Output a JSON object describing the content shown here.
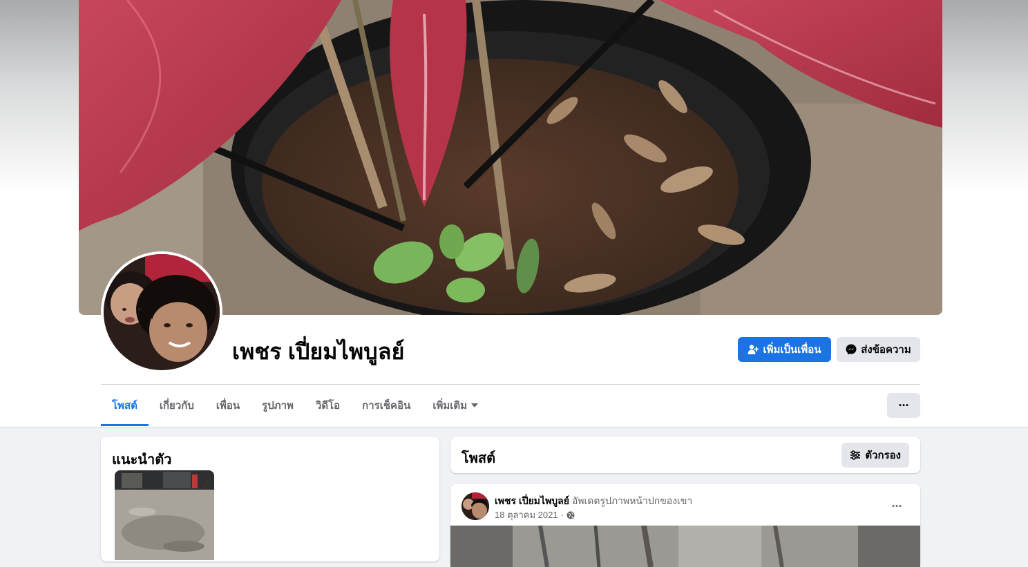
{
  "profile": {
    "name": "เพชร เปี่ยมไพบูลย์"
  },
  "actions": {
    "add_friend": "เพิ่มเป็นเพื่อน",
    "message": "ส่งข้อความ",
    "more": "···"
  },
  "tabs": [
    {
      "label": "โพสต์",
      "active": true
    },
    {
      "label": "เกี่ยวกับ",
      "active": false
    },
    {
      "label": "เพื่อน",
      "active": false
    },
    {
      "label": "รูปภาพ",
      "active": false
    },
    {
      "label": "วิดีโอ",
      "active": false
    },
    {
      "label": "การเช็คอิน",
      "active": false
    },
    {
      "label": "เพิ่มเติม",
      "active": false
    }
  ],
  "intro": {
    "title": "แนะนำตัว"
  },
  "posts": {
    "title": "โพสต์",
    "filter_label": "ตัวกรอง"
  },
  "post": {
    "author": "เพชร เปี่ยมไพบูลย์",
    "action": "อัพเดตรูปภาพหน้าปกของเขา",
    "date": "18 ตุลาคม 2021",
    "separator": "·",
    "privacy_icon": "globe-icon",
    "more": "···"
  },
  "colors": {
    "accent": "#1b74e4",
    "secondary_button": "#e4e6eb",
    "page_background": "#f0f2f5"
  }
}
